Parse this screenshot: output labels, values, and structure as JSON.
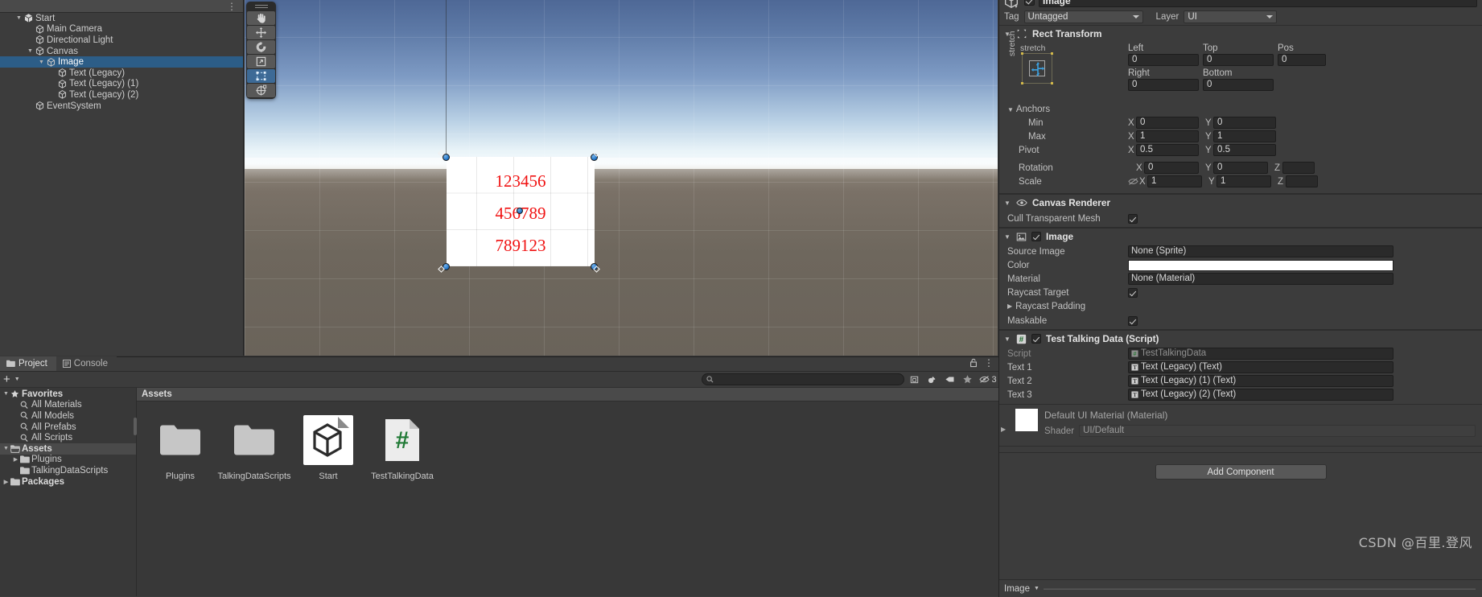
{
  "hierarchy": {
    "kebab": "⋮",
    "nodes": [
      {
        "label": "Start",
        "depth": 0,
        "twisty": "▼",
        "icon": "unity-scene-icon",
        "selected": false
      },
      {
        "label": "Main Camera",
        "depth": 1,
        "twisty": "",
        "icon": "gameobject-icon",
        "selected": false
      },
      {
        "label": "Directional Light",
        "depth": 1,
        "twisty": "",
        "icon": "gameobject-icon",
        "selected": false
      },
      {
        "label": "Canvas",
        "depth": 1,
        "twisty": "▼",
        "icon": "gameobject-icon",
        "selected": false
      },
      {
        "label": "Image",
        "depth": 2,
        "twisty": "▼",
        "icon": "gameobject-icon",
        "selected": true
      },
      {
        "label": "Text (Legacy)",
        "depth": 3,
        "twisty": "",
        "icon": "gameobject-icon",
        "selected": false
      },
      {
        "label": "Text (Legacy) (1)",
        "depth": 3,
        "twisty": "",
        "icon": "gameobject-icon",
        "selected": false
      },
      {
        "label": "Text (Legacy) (2)",
        "depth": 3,
        "twisty": "",
        "icon": "gameobject-icon",
        "selected": false
      },
      {
        "label": "EventSystem",
        "depth": 1,
        "twisty": "",
        "icon": "gameobject-icon",
        "selected": false
      }
    ]
  },
  "scene": {
    "tools": [
      {
        "name": "hand-tool",
        "active": false
      },
      {
        "name": "move-tool",
        "active": false
      },
      {
        "name": "rotate-tool",
        "active": false
      },
      {
        "name": "scale-tool",
        "active": false
      },
      {
        "name": "rect-tool",
        "active": true
      },
      {
        "name": "transform-tool",
        "active": false
      }
    ],
    "ui_texts": [
      "123456",
      "456789",
      "789123"
    ],
    "ui_text_color": "#f01212"
  },
  "inspector": {
    "object_name": "Image",
    "tag_label": "Tag",
    "tag_value": "Untagged",
    "layer_label": "Layer",
    "layer_value": "UI",
    "rect_transform": {
      "title": "Rect Transform",
      "anchor_preset_h": "stretch",
      "anchor_preset_v": "stretch",
      "left_label": "Left",
      "left_value": "0",
      "top_label": "Top",
      "top_value": "0",
      "right_label": "Right",
      "right_value": "0",
      "bottom_label": "Bottom",
      "bottom_value": "0",
      "posz_label": "Pos",
      "posz_value": "0",
      "anchors_label": "Anchors",
      "min_label": "Min",
      "min_x": "0",
      "min_y": "0",
      "max_label": "Max",
      "max_x": "1",
      "max_y": "1",
      "pivot_label": "Pivot",
      "pivot_x": "0.5",
      "pivot_y": "0.5",
      "rotation_label": "Rotation",
      "rot_x": "0",
      "rot_y": "0",
      "rot_z_axis": "Z",
      "scale_label": "Scale",
      "scale_x": "1",
      "scale_y": "1",
      "scale_z_axis": "Z",
      "axis_x": "X",
      "axis_y": "Y"
    },
    "canvas_renderer": {
      "title": "Canvas Renderer",
      "cull_label": "Cull Transparent Mesh",
      "cull_checked": true
    },
    "image": {
      "title": "Image",
      "enabled": true,
      "source_image_label": "Source Image",
      "source_image_value": "None (Sprite)",
      "color_label": "Color",
      "color_value": "#FFFFFF",
      "material_label": "Material",
      "material_value": "None (Material)",
      "raycast_target_label": "Raycast Target",
      "raycast_target_checked": true,
      "raycast_padding_label": "Raycast Padding",
      "maskable_label": "Maskable",
      "maskable_checked": true
    },
    "script_component": {
      "title": "Test Talking Data (Script)",
      "enabled": true,
      "script_label": "Script",
      "script_value": "TestTalkingData",
      "fields": [
        {
          "label": "Text 1",
          "value": "Text (Legacy) (Text)"
        },
        {
          "label": "Text 2",
          "value": "Text (Legacy) (1) (Text)"
        },
        {
          "label": "Text 3",
          "value": "Text (Legacy) (2) (Text)"
        }
      ]
    },
    "material_preview": {
      "title": "Default UI Material (Material)",
      "shader_label": "Shader",
      "shader_value": "UI/Default"
    },
    "add_component_label": "Add Component",
    "watermark": "CSDN @百里.登风",
    "footer_label": "Image"
  },
  "project": {
    "tabs": [
      {
        "label": "Project",
        "icon": "folder-icon",
        "active": true
      },
      {
        "label": "Console",
        "icon": "console-icon",
        "active": false
      }
    ],
    "lock_icon": "lock-icon",
    "kebab_icon": "⋮",
    "create_label": "+",
    "search_placeholder": "",
    "search_value": "",
    "toolbar_icons": [
      "save-search-icon",
      "type-filter-icon",
      "label-filter-icon",
      "favorite-icon",
      "hidden-packages-icon"
    ],
    "hidden_count": "3",
    "tree": [
      {
        "label": "Favorites",
        "depth": 0,
        "twisty": "▼",
        "icon": "star-icon",
        "bold": true,
        "sel": false
      },
      {
        "label": "All Materials",
        "depth": 1,
        "twisty": "",
        "icon": "search-icon",
        "bold": false,
        "sel": false
      },
      {
        "label": "All Models",
        "depth": 1,
        "twisty": "",
        "icon": "search-icon",
        "bold": false,
        "sel": false
      },
      {
        "label": "All Prefabs",
        "depth": 1,
        "twisty": "",
        "icon": "search-icon",
        "bold": false,
        "sel": false
      },
      {
        "label": "All Scripts",
        "depth": 1,
        "twisty": "",
        "icon": "search-icon",
        "bold": false,
        "sel": false
      },
      {
        "label": "Assets",
        "depth": 0,
        "twisty": "▼",
        "icon": "folder-open-icon",
        "bold": true,
        "sel": true
      },
      {
        "label": "Plugins",
        "depth": 1,
        "twisty": "▶",
        "icon": "folder-icon",
        "bold": false,
        "sel": false
      },
      {
        "label": "TalkingDataScripts",
        "depth": 1,
        "twisty": "",
        "icon": "folder-icon",
        "bold": false,
        "sel": false
      },
      {
        "label": "Packages",
        "depth": 0,
        "twisty": "▶",
        "icon": "folder-icon",
        "bold": true,
        "sel": false
      }
    ],
    "breadcrumb": "Assets",
    "assets": [
      {
        "label": "Plugins",
        "type": "folder",
        "selected": false
      },
      {
        "label": "TalkingDataScripts",
        "type": "folder",
        "selected": false
      },
      {
        "label": "Start",
        "type": "scene",
        "selected": true
      },
      {
        "label": "TestTalkingData",
        "type": "script",
        "selected": false
      }
    ]
  }
}
